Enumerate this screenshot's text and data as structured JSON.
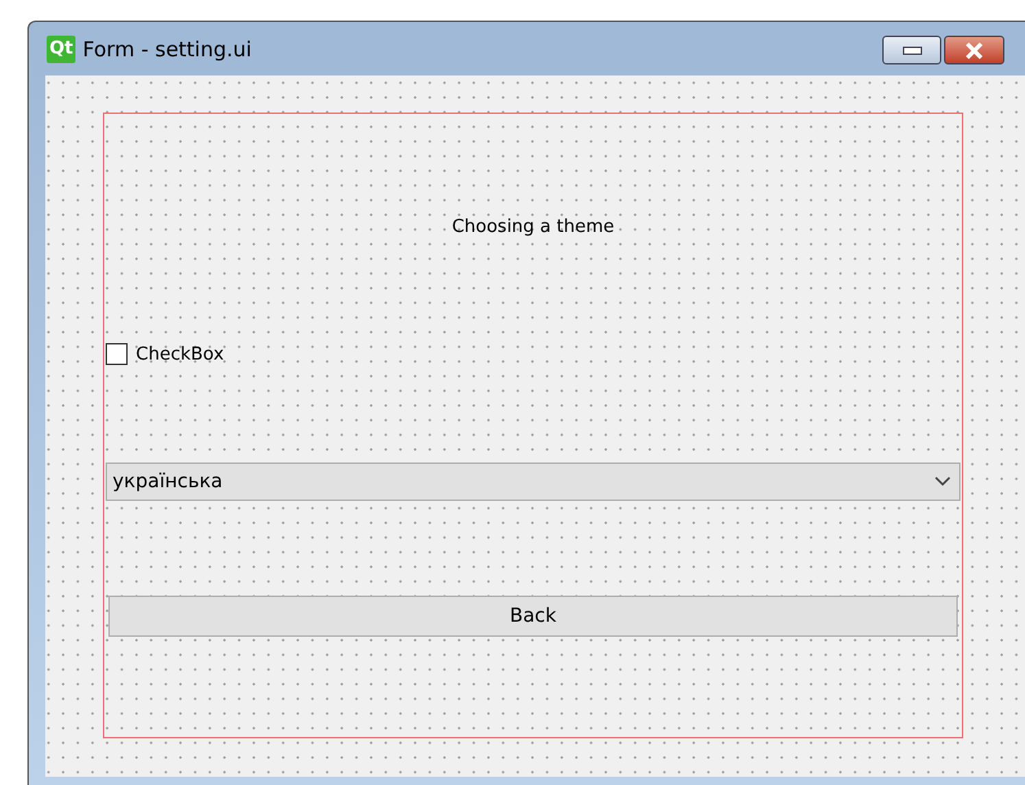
{
  "window": {
    "title": "Form - setting.ui",
    "app_badge": "Qt"
  },
  "form": {
    "label": "Choosing a theme",
    "checkbox": {
      "label": "CheckBox",
      "checked": false
    },
    "combo": {
      "value": "українська"
    },
    "button": {
      "label": "Back"
    }
  }
}
